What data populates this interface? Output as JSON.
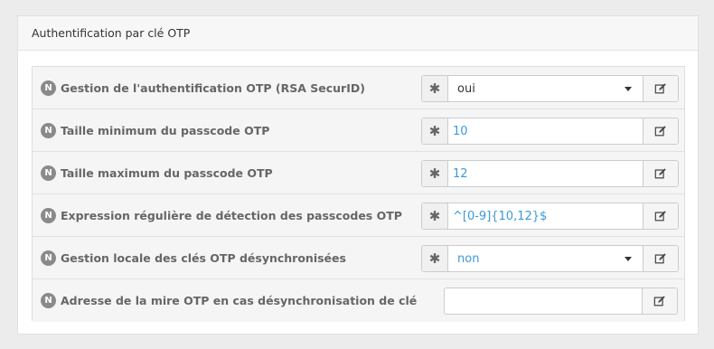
{
  "panel": {
    "title": "Authentification par clé OTP"
  },
  "badge": "N",
  "required_marker": "✱",
  "rows": [
    {
      "label": "Gestion de l'authentification OTP (RSA SecurID)",
      "value": "oui",
      "type": "select",
      "required": true
    },
    {
      "label": "Taille minimum du passcode OTP",
      "value": "10",
      "type": "text",
      "required": true
    },
    {
      "label": "Taille maximum du passcode OTP",
      "value": "12",
      "type": "text",
      "required": true
    },
    {
      "label": "Expression régulière de détection des passcodes OTP",
      "value": "^[0-9]{10,12}$",
      "type": "text",
      "required": true
    },
    {
      "label": "Gestion locale des clés OTP désynchronisées",
      "value": "non",
      "type": "select",
      "required": true
    },
    {
      "label": "Adresse de la mire OTP en cas désynchronisation de clé",
      "value": "",
      "type": "text",
      "required": false
    }
  ],
  "icons": {
    "edit": "pencil-square-icon",
    "caret": "caret-down-icon"
  },
  "colors": {
    "value_blue": "#3a9ad9",
    "badge_gray": "#8a8a8a"
  }
}
